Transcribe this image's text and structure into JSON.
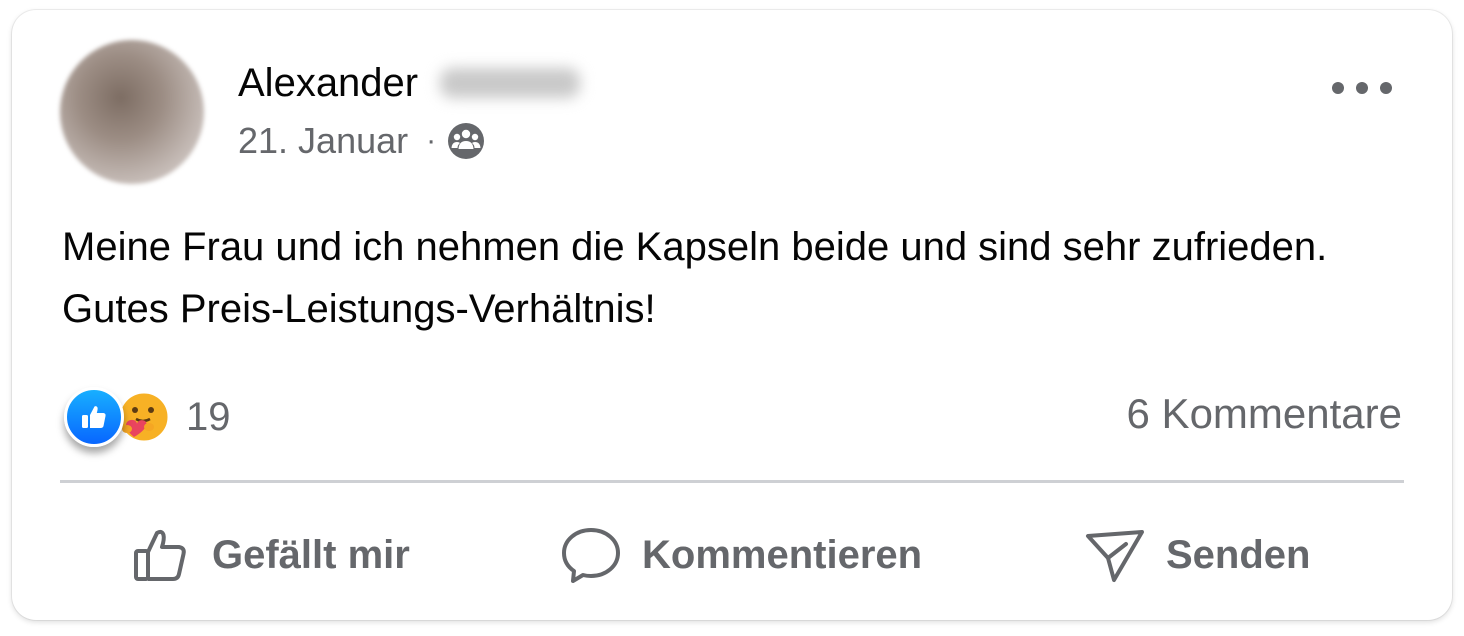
{
  "post": {
    "author": {
      "name": "Alexander",
      "avatar_icon": "avatar-blurred"
    },
    "date": "21. Januar",
    "separator": "·",
    "audience_icon": "friends-group-icon",
    "more_icon": "ellipsis-icon",
    "text": "Meine Frau und ich nehmen die Kapseln beide und sind sehr zufrieden. Gutes Preis-Leistungs-Verhältnis!",
    "reactions": {
      "types": [
        "like",
        "care"
      ],
      "count": "19"
    },
    "comments_label": "6 Kommentare",
    "actions": {
      "like_label": "Gefällt mir",
      "comment_label": "Kommentieren",
      "share_label": "Senden"
    }
  },
  "colors": {
    "text_primary": "#050505",
    "text_secondary": "#65676b",
    "like_blue": "#0866ff",
    "divider": "#ced0d4"
  }
}
